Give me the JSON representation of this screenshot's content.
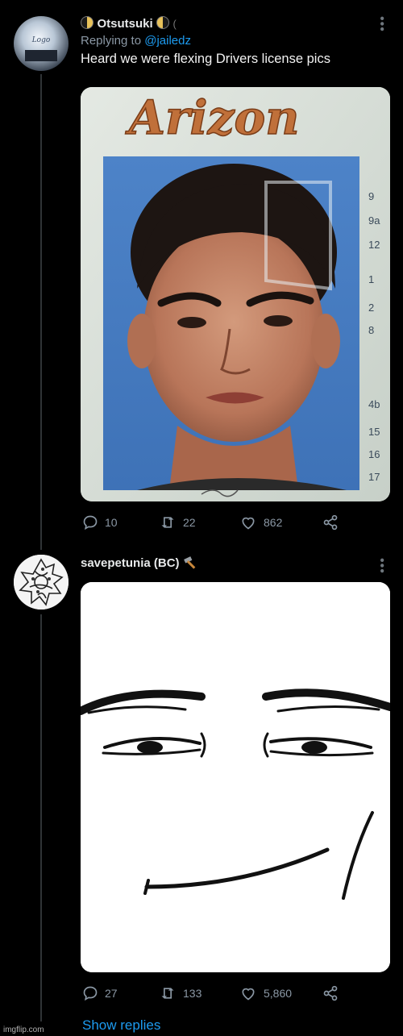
{
  "tweet1": {
    "name": "Otsutsuki",
    "replying_to_prefix": "Replying to",
    "replying_to_handle": "@jailedz",
    "text": "Heard we were flexing Drivers license pics",
    "license": {
      "state": "Arizon",
      "field_numbers": [
        "9",
        "9a",
        "12",
        "1",
        "2",
        "8",
        "4b",
        "15",
        "16",
        "17"
      ]
    },
    "stats": {
      "replies": "10",
      "retweets": "22",
      "likes": "862"
    }
  },
  "tweet2": {
    "name": "savepetunia (BC)",
    "stats": {
      "replies": "27",
      "retweets": "133",
      "likes": "5,860"
    }
  },
  "show_replies": "Show replies",
  "watermark": "imgflip.com",
  "colors": {
    "background": "#000000",
    "link": "#1d9bf0",
    "muted": "#8b98a5"
  }
}
